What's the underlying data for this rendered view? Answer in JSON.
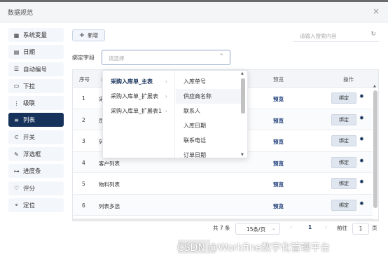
{
  "dialog": {
    "title": "数据规范",
    "close_glyph": "×"
  },
  "sidebar": {
    "items": [
      {
        "label": "系统变量",
        "icon": "grid-icon",
        "glyph": "▦"
      },
      {
        "label": "日期",
        "icon": "calendar-icon",
        "glyph": "▤"
      },
      {
        "label": "自动编号",
        "icon": "numbered-list-icon",
        "glyph": "☰"
      },
      {
        "label": "下拉",
        "icon": "dropdown-icon",
        "glyph": "▭"
      },
      {
        "label": "级联",
        "icon": "cascade-icon",
        "glyph": "⋮"
      },
      {
        "label": "列表",
        "icon": "list-icon",
        "glyph": "≡"
      },
      {
        "label": "开关",
        "icon": "toggle-icon",
        "glyph": "⊂"
      },
      {
        "label": "浮选框",
        "icon": "edit-box-icon",
        "glyph": "✎"
      },
      {
        "label": "进度条",
        "icon": "progress-icon",
        "glyph": "⊶"
      },
      {
        "label": "评分",
        "icon": "heart-icon",
        "glyph": "♡"
      },
      {
        "label": "定位",
        "icon": "location-icon",
        "glyph": "⌖"
      }
    ],
    "active_index": 5
  },
  "toolbar": {
    "add_label": "新增",
    "add_glyph": "+"
  },
  "search": {
    "placeholder": "请输入搜索内容",
    "icon": "refresh-icon",
    "glyph": "↻"
  },
  "bind_field": {
    "label": "绑定字段",
    "placeholder": "请选择",
    "arrow_glyph": "⌃"
  },
  "table": {
    "headers": {
      "index": "序号",
      "name": "名",
      "preview": "预览",
      "action": "操作"
    },
    "rows": [
      {
        "index": "1",
        "name": "采",
        "preview": "预览",
        "bind": "绑定"
      },
      {
        "index": "2",
        "name": "员",
        "preview": "预览",
        "bind": "绑定"
      },
      {
        "index": "3",
        "name": "列",
        "preview": "预览",
        "bind": "绑定"
      },
      {
        "index": "4",
        "name": "客户列表",
        "preview": "预览",
        "bind": "绑定"
      },
      {
        "index": "5",
        "name": "物料列表",
        "preview": "预览",
        "bind": "绑定"
      },
      {
        "index": "6",
        "name": "列表多选",
        "preview": "预览",
        "bind": "绑定"
      }
    ]
  },
  "cascader": {
    "level1": [
      {
        "label": "采购入库单_主表",
        "active": true
      },
      {
        "label": "采购入库单_扩展表",
        "active": false
      },
      {
        "label": "采购入库单_扩展表1",
        "active": false
      }
    ],
    "level2": [
      "入库单号",
      "供应商名称",
      "联系人",
      "入库日期",
      "联系电话",
      "订单日期"
    ],
    "hover_index": 1
  },
  "pagination": {
    "total": "共 7 条",
    "page_size": "15条/页",
    "current": "1",
    "goto_label": "前往",
    "goto_value": "1",
    "page_unit": "页"
  },
  "watermark": "CSDN @Workfine数字化管理平台",
  "colors": {
    "accent": "#17325b",
    "preview_link": "#1a3a78"
  }
}
